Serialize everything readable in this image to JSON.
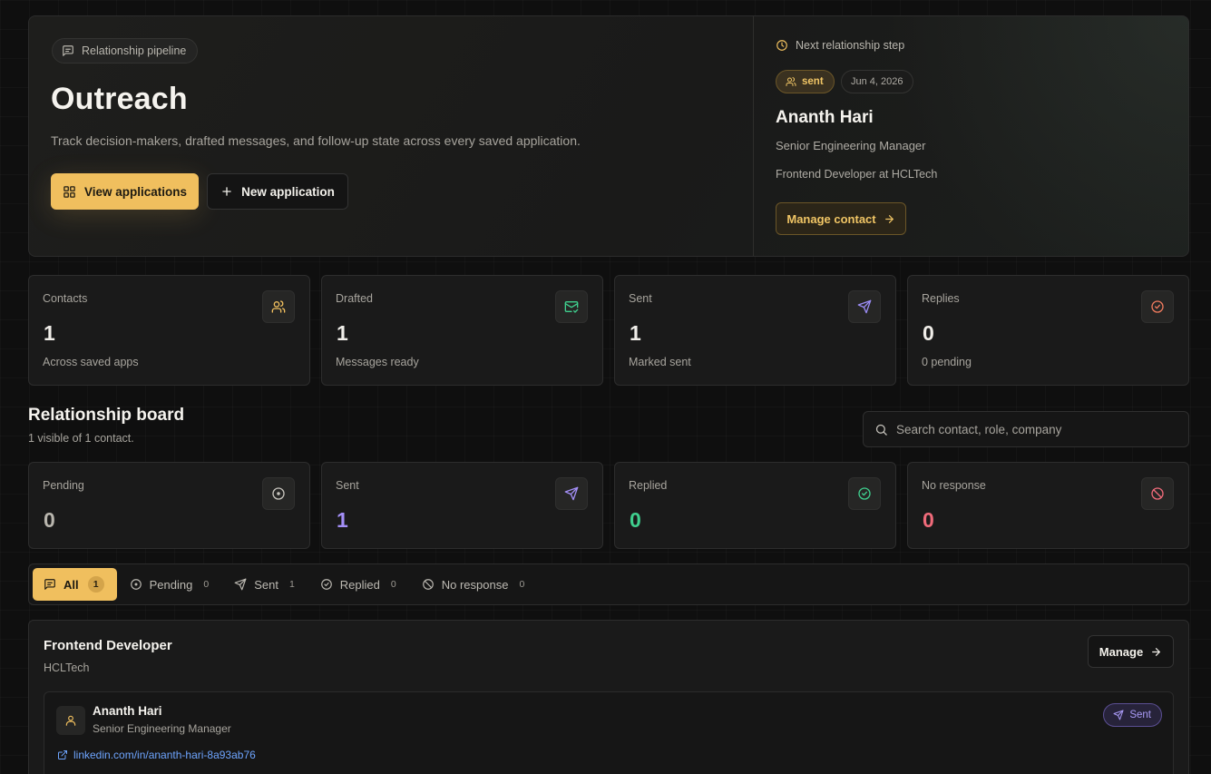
{
  "hero": {
    "tag_label": "Relationship pipeline",
    "title": "Outreach",
    "subtitle": "Track decision-makers, drafted messages, and follow-up state across every saved application.",
    "primary_button": "View applications",
    "secondary_button": "New application"
  },
  "next_step": {
    "label": "Next relationship step",
    "status_badge": "sent",
    "date": "Jun 4, 2026",
    "name": "Ananth Hari",
    "role": "Senior Engineering Manager",
    "application": "Frontend Developer at HCLTech",
    "manage_button": "Manage contact"
  },
  "stats": [
    {
      "label": "Contacts",
      "value": "1",
      "note": "Across saved apps",
      "icon": "users-icon",
      "color": "#f0bf5e"
    },
    {
      "label": "Drafted",
      "value": "1",
      "note": "Messages ready",
      "icon": "mail-check-icon",
      "color": "#3fcf8e"
    },
    {
      "label": "Sent",
      "value": "1",
      "note": "Marked sent",
      "icon": "send-icon",
      "color": "#9b8cf5"
    },
    {
      "label": "Replies",
      "value": "0",
      "note": "0 pending",
      "icon": "check-circle-icon",
      "color": "#f07b5e"
    }
  ],
  "board": {
    "title": "Relationship board",
    "subtitle": "1 visible of 1 contact.",
    "search_placeholder": "Search contact, role, company"
  },
  "status_cards": [
    {
      "label": "Pending",
      "value": "0",
      "icon": "pending-circle-icon",
      "color": "#b9b6ae"
    },
    {
      "label": "Sent",
      "value": "1",
      "icon": "send-icon",
      "color": "#a48ff7"
    },
    {
      "label": "Replied",
      "value": "0",
      "icon": "check-circle-icon",
      "color": "#3fcf8e"
    },
    {
      "label": "No response",
      "value": "0",
      "icon": "ban-icon",
      "color": "#f06b7a"
    }
  ],
  "filters": [
    {
      "label": "All",
      "count": "1",
      "icon": "message-icon",
      "active": true
    },
    {
      "label": "Pending",
      "count": "0",
      "icon": "pending-circle-icon",
      "active": false
    },
    {
      "label": "Sent",
      "count": "1",
      "icon": "send-icon",
      "active": false
    },
    {
      "label": "Replied",
      "count": "0",
      "icon": "check-circle-icon",
      "active": false
    },
    {
      "label": "No response",
      "count": "0",
      "icon": "ban-icon",
      "active": false
    }
  ],
  "application": {
    "title": "Frontend Developer",
    "company": "HCLTech",
    "manage_button": "Manage",
    "contact": {
      "name": "Ananth Hari",
      "role": "Senior Engineering Manager",
      "link": "linkedin.com/in/ananth-hari-8a93ab76",
      "status": "Sent"
    }
  },
  "colors": {
    "accent": "#f0bf5e",
    "sent": "#a48ff7",
    "replied": "#3fcf8e",
    "no_response": "#f06b7a",
    "link": "#6ea5ff"
  }
}
